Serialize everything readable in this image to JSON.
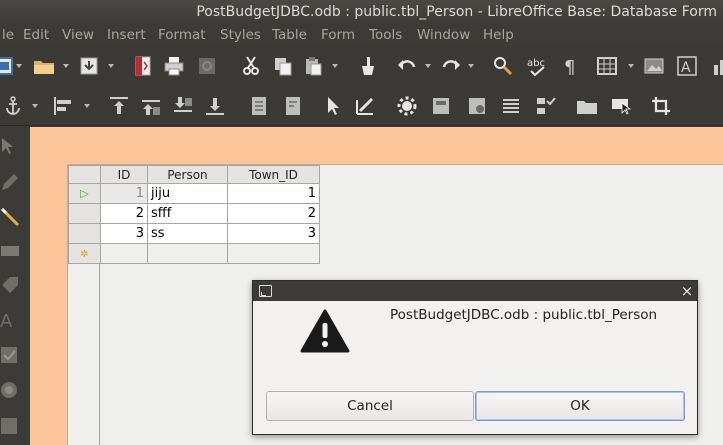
{
  "window": {
    "title": "PostBudgetJDBC.odb : public.tbl_Person - LibreOffice Base: Database Form"
  },
  "menu": {
    "items": [
      "le",
      "Edit",
      "View",
      "Insert",
      "Format",
      "Styles",
      "Table",
      "Form",
      "Tools",
      "Window",
      "Help"
    ]
  },
  "grid": {
    "columns": [
      "ID",
      "Person",
      "Town_ID"
    ],
    "rows": [
      {
        "id": "1",
        "person": "jiju",
        "town_id": "1"
      },
      {
        "id": "2",
        "person": "sfff",
        "town_id": "2"
      },
      {
        "id": "3",
        "person": "ss",
        "town_id": "3"
      }
    ],
    "current_row_marker": "▷",
    "new_row_marker": "✲"
  },
  "dialog": {
    "message": "PostBudgetJDBC.odb : public.tbl_Person",
    "close_glyph": "×",
    "cancel_label": "Cancel",
    "ok_label": "OK"
  },
  "colors": {
    "form_background": "#fdc69a",
    "chrome": "#3c3b37",
    "current_row_marker": "#3fae29",
    "new_row_marker": "#e0a300"
  }
}
